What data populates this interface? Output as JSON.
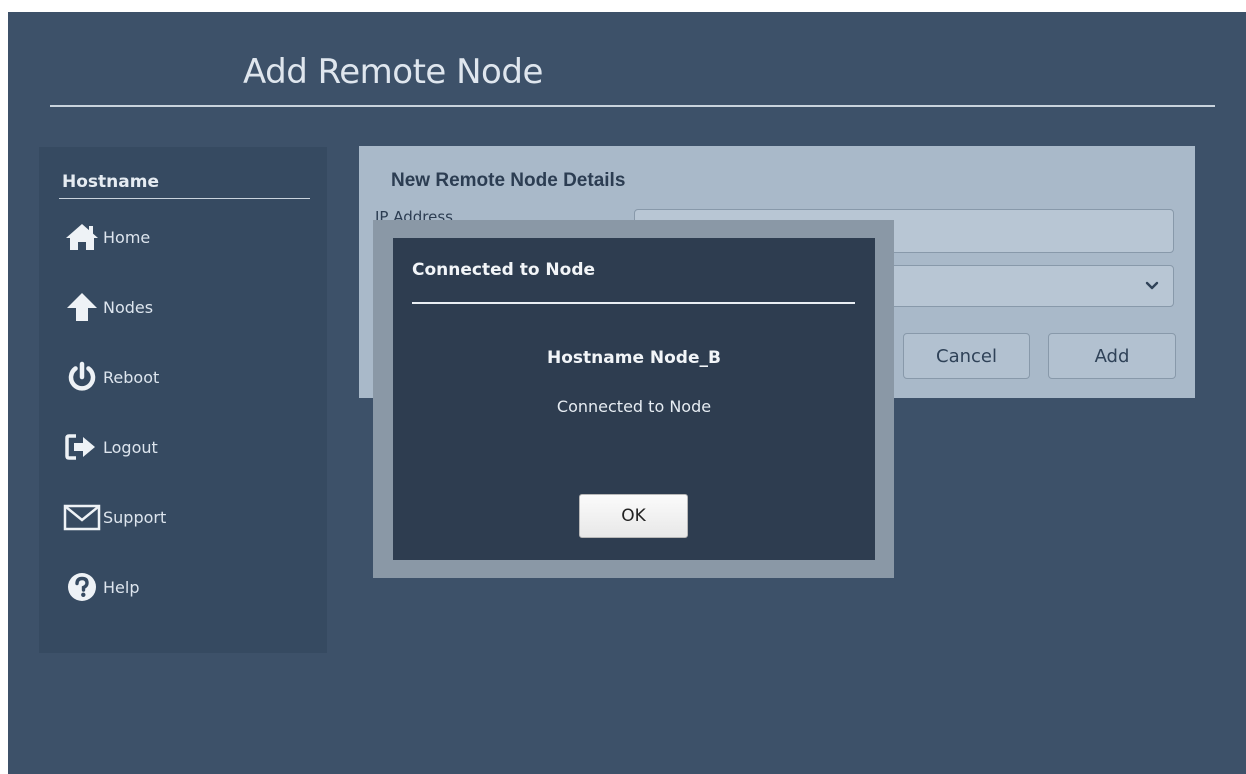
{
  "page": {
    "title": "Add Remote Node"
  },
  "sidebar": {
    "header": "Hostname",
    "items": [
      {
        "label": "Home",
        "icon": "home-icon"
      },
      {
        "label": "Nodes",
        "icon": "arrow-up-icon"
      },
      {
        "label": "Reboot",
        "icon": "power-icon"
      },
      {
        "label": "Logout",
        "icon": "logout-icon"
      },
      {
        "label": "Support",
        "icon": "envelope-icon"
      },
      {
        "label": "Help",
        "icon": "question-circle-icon"
      }
    ]
  },
  "details": {
    "title": "New Remote Node Details",
    "ip_label": "IP Address",
    "ip_value": "",
    "node_select_value": "",
    "cancel_label": "Cancel",
    "add_label": "Add"
  },
  "modal": {
    "title": "Connected to Node",
    "hostname": "Hostname Node_B",
    "message": "Connected to Node",
    "ok_label": "OK"
  },
  "colors": {
    "background": "#3d5169",
    "sidebar": "#364a61",
    "panel": "#a9b9c9",
    "modal": "#2e3d50",
    "modal_frame": "#8a98a6"
  }
}
